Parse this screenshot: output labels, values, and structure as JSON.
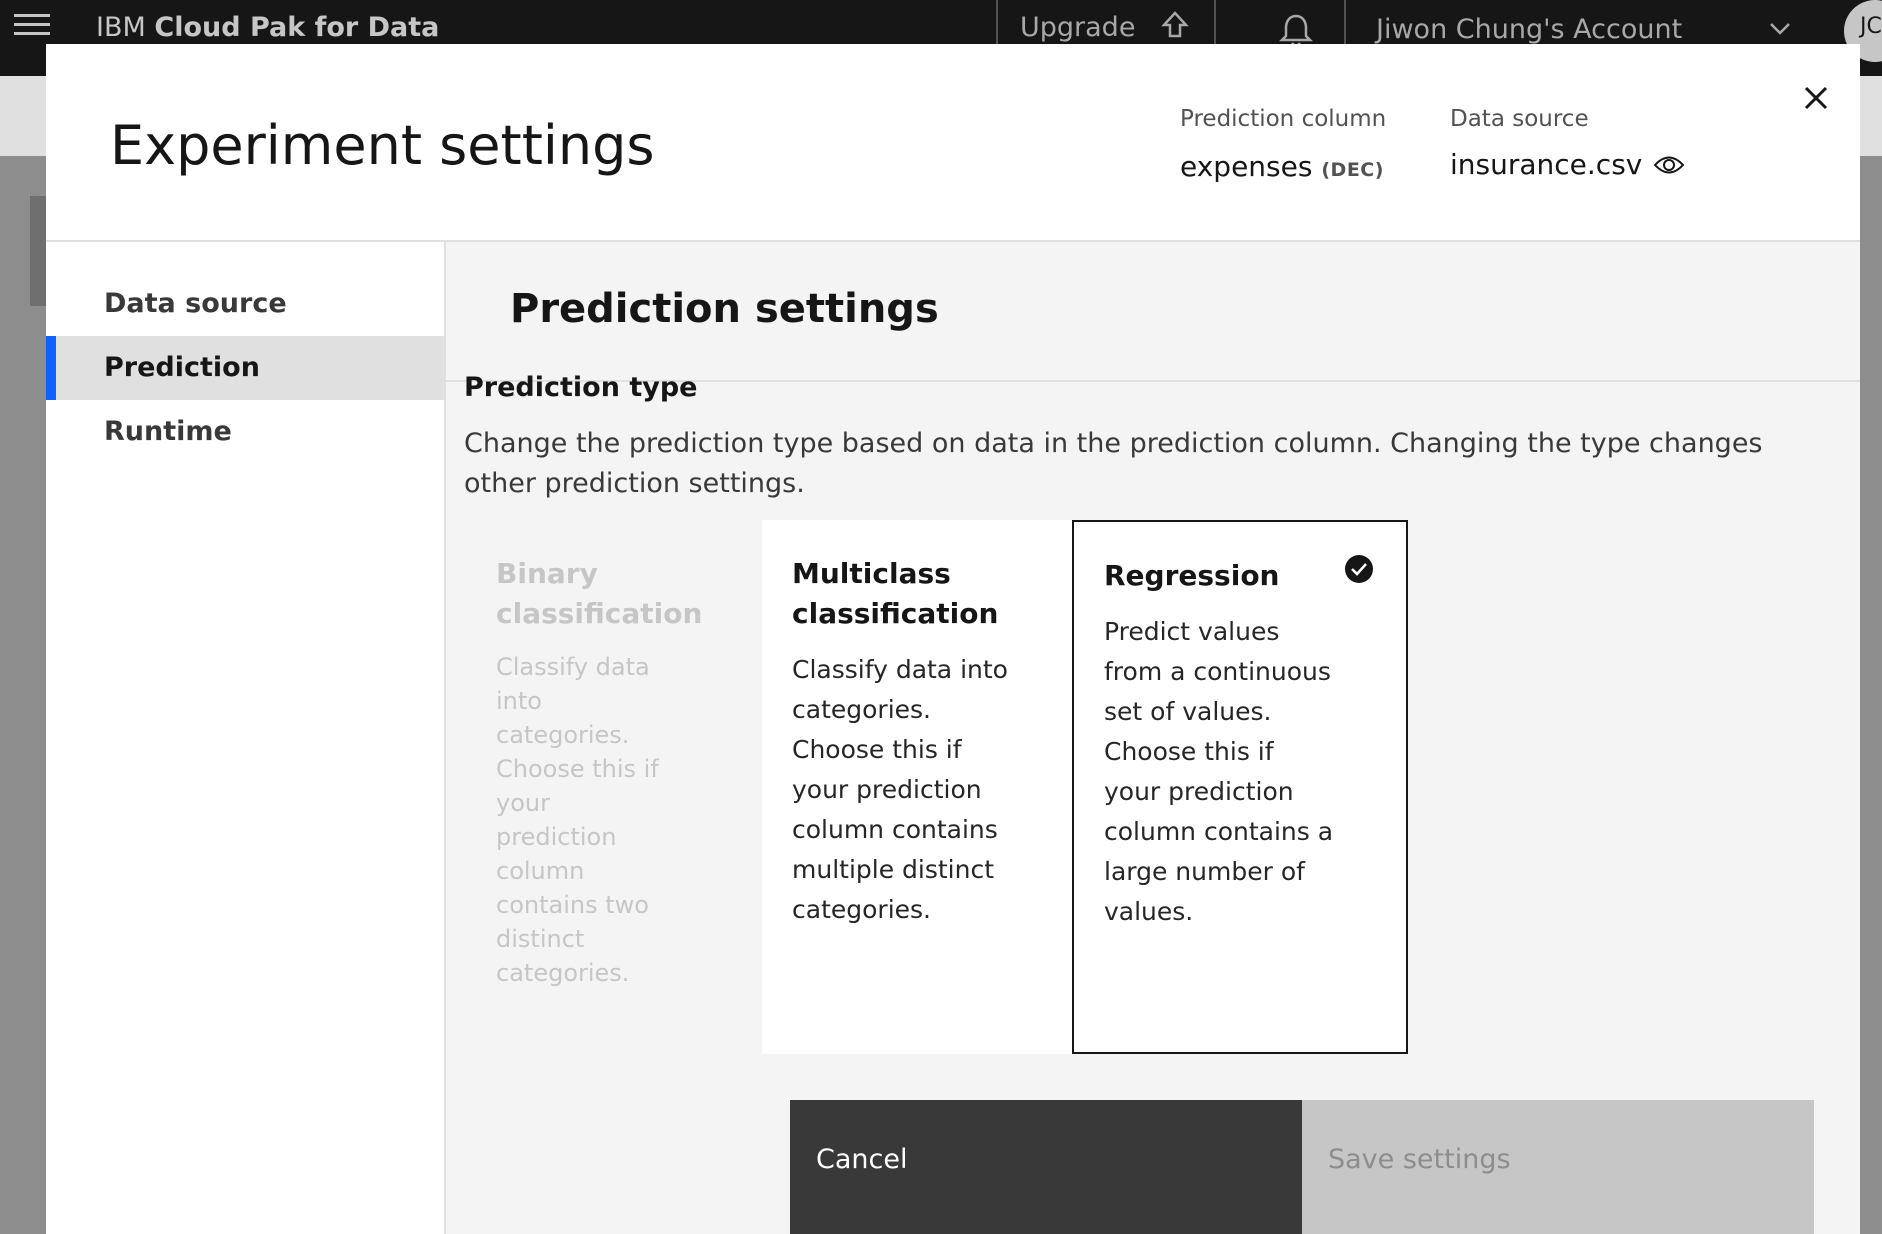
{
  "topbar": {
    "brand_prefix": "IBM",
    "brand_name": "Cloud Pak for Data",
    "upgrade_label": "Upgrade",
    "account_name": "Jiwon Chung's Account",
    "avatar_initials": "JC"
  },
  "modal": {
    "title": "Experiment settings",
    "prediction_column_label": "Prediction column",
    "prediction_column_value": "expenses",
    "prediction_column_type": "(DEC)",
    "data_source_label": "Data source",
    "data_source_value": "insurance.csv"
  },
  "sidebar": {
    "items": [
      {
        "label": "Data source",
        "active": false
      },
      {
        "label": "Prediction",
        "active": true
      },
      {
        "label": "Runtime",
        "active": false
      }
    ]
  },
  "main": {
    "section_title": "Prediction settings",
    "prediction_type_title": "Prediction type",
    "prediction_type_desc": "Change the prediction type based on data in the prediction column. Changing the type changes other prediction settings.",
    "tiles": [
      {
        "title": "Binary classification",
        "desc": "Classify data into categories. Choose this if your prediction column contains two distinct categories.",
        "state": "disabled"
      },
      {
        "title": "Multiclass classification",
        "desc": "Classify data into categories. Choose this if your prediction column contains multiple distinct categories.",
        "state": "unselected"
      },
      {
        "title": "Regression",
        "desc": "Predict values from a continuous set of values. Choose this if your prediction column contains a large number of values.",
        "state": "selected"
      }
    ]
  },
  "footer": {
    "cancel_label": "Cancel",
    "save_label": "Save settings"
  },
  "colors": {
    "accent": "#0f62fe",
    "header_bg": "#161616",
    "selected_border": "#161616"
  }
}
